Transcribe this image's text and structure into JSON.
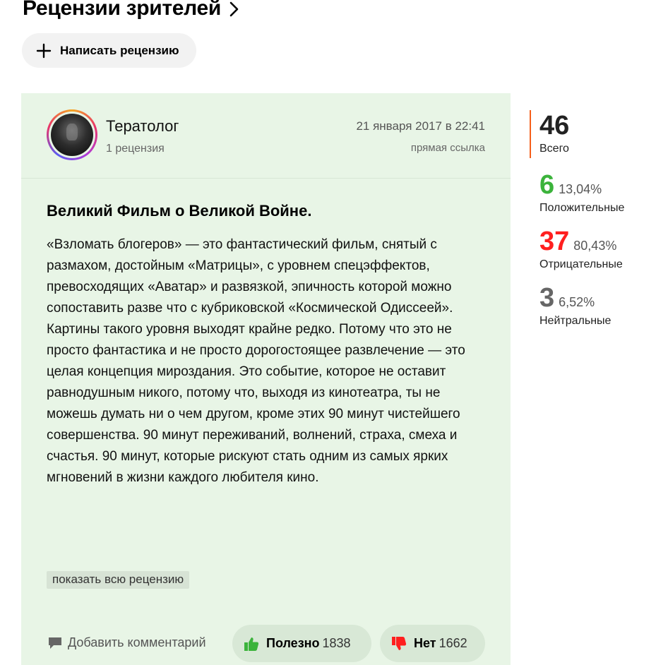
{
  "section": {
    "title": "Рецензии зрителей",
    "write_label": "Написать рецензию"
  },
  "review": {
    "author_name": "Тератолог",
    "author_reviews": "1 рецензия",
    "date": "21 января 2017 в 22:41",
    "permalink": "прямая ссылка",
    "title": "Великий Фильм о Великой Войне.",
    "text": "«Взломать блогеров» — это фантастический фильм, снятый с размахом, достойным «Матрицы», с уровнем спецэффектов, превосходящих «Аватар» и развязкой, эпичность которой можно сопоставить разве что с кубриковской «Космической Одиссеей». Картины такого уровня выходят крайне редко. Потому что это не просто фантастика и не просто дорогостоящее развлечение — это целая концепция мироздания. Это событие, которое не оставит равнодушным никого, потому что, выходя из кинотеатра, ты не можешь думать ни о чем другом, кроме этих 90 минут чистейшего совершенства. 90 минут переживаний, волнений, страха, смеха и счастья. 90 минут, которые рискуют стать одним из самых ярких мгновений в жизни каждого любителя кино.",
    "show_full": "показать всю рецензию",
    "add_comment": "Добавить комментарий",
    "useful_label": "Полезно",
    "useful_count": "1838",
    "no_label": "Нет",
    "no_count": "1662",
    "card_color": "#e8f5e6"
  },
  "stats": {
    "total": "46",
    "total_label": "Всего",
    "positive": "6",
    "positive_pct": "13,04%",
    "positive_label": "Положительные",
    "negative": "37",
    "negative_pct": "80,43%",
    "negative_label": "Отрицательные",
    "neutral": "3",
    "neutral_pct": "6,52%",
    "neutral_label": "Нейтральные",
    "colors": {
      "accent": "#f55f1a",
      "positive": "#3bb33b",
      "negative": "#ff1f1f",
      "neutral": "#666666"
    }
  }
}
